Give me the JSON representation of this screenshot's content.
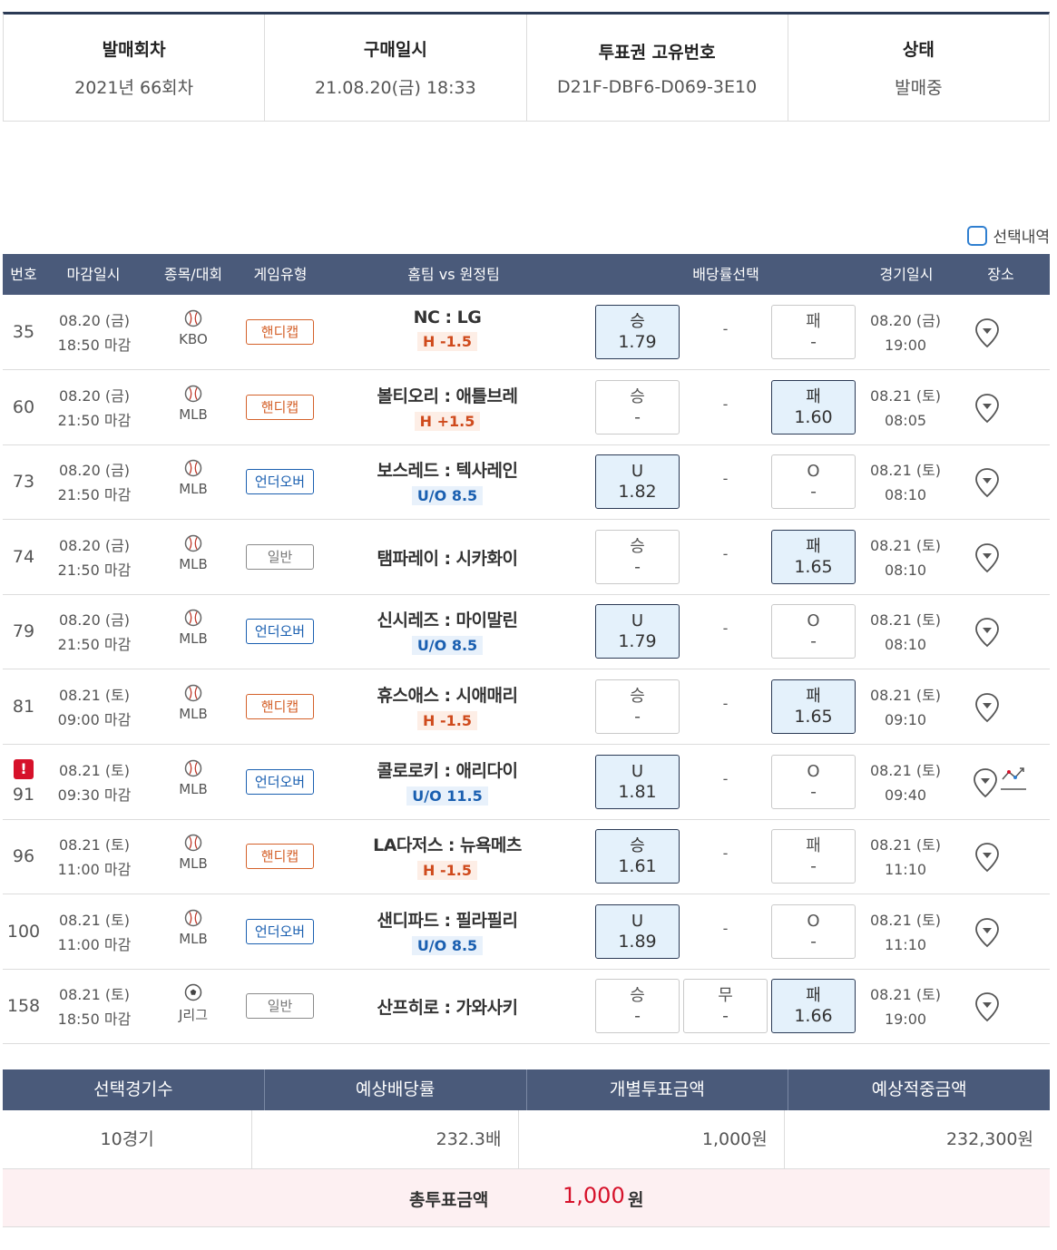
{
  "ticket_info": {
    "round_label": "발매회차",
    "round_value": "2021년 66회차",
    "purchase_label": "구매일시",
    "purchase_value": "21.08.20(금) 18:33",
    "ticket_id_label": "투표권 고유번호",
    "ticket_id_value": "D21F-DBF6-D069-3E10",
    "status_label": "상태",
    "status_value": "발매중"
  },
  "selection_toggle": {
    "label": "선택내역",
    "checked": false
  },
  "table": {
    "headers": {
      "no": "번호",
      "deadline": "마감일시",
      "sport": "종목/대회",
      "game_type": "게임유형",
      "teams": "홈팀 vs 원정팀",
      "odds": "배당률선택",
      "game_time": "경기일시",
      "place": "장소"
    },
    "rows": [
      {
        "no": "35",
        "dl_date": "08.20 (금)",
        "dl_time": "18:50 마감",
        "sport": "KBO",
        "sport_icon": "baseball-icon",
        "type": "핸디캡",
        "type_kind": "h",
        "home": "NC",
        "away": "LG",
        "hc": "H -1.5",
        "opt_l": "승",
        "val_l": "1.79",
        "sel_l": true,
        "mid": "-",
        "opt_r": "패",
        "val_r": "-",
        "sel_r": false,
        "gd_date": "08.20 (금)",
        "gd_time": "19:00"
      },
      {
        "no": "60",
        "dl_date": "08.20 (금)",
        "dl_time": "21:50 마감",
        "sport": "MLB",
        "sport_icon": "baseball-icon",
        "type": "핸디캡",
        "type_kind": "h",
        "home": "볼티오리",
        "away": "애틀브레",
        "hc": "H +1.5",
        "opt_l": "승",
        "val_l": "-",
        "sel_l": false,
        "mid": "-",
        "opt_r": "패",
        "val_r": "1.60",
        "sel_r": true,
        "gd_date": "08.21 (토)",
        "gd_time": "08:05"
      },
      {
        "no": "73",
        "dl_date": "08.20 (금)",
        "dl_time": "21:50 마감",
        "sport": "MLB",
        "sport_icon": "baseball-icon",
        "type": "언더오버",
        "type_kind": "u",
        "home": "보스레드",
        "away": "텍사레인",
        "hc": "U/O 8.5",
        "opt_l": "U",
        "val_l": "1.82",
        "sel_l": true,
        "mid": "-",
        "opt_r": "O",
        "val_r": "-",
        "sel_r": false,
        "gd_date": "08.21 (토)",
        "gd_time": "08:10"
      },
      {
        "no": "74",
        "dl_date": "08.20 (금)",
        "dl_time": "21:50 마감",
        "sport": "MLB",
        "sport_icon": "baseball-icon",
        "type": "일반",
        "type_kind": "n",
        "home": "탬파레이",
        "away": "시카화이",
        "hc": "",
        "opt_l": "승",
        "val_l": "-",
        "sel_l": false,
        "mid": "-",
        "opt_r": "패",
        "val_r": "1.65",
        "sel_r": true,
        "gd_date": "08.21 (토)",
        "gd_time": "08:10"
      },
      {
        "no": "79",
        "dl_date": "08.20 (금)",
        "dl_time": "21:50 마감",
        "sport": "MLB",
        "sport_icon": "baseball-icon",
        "type": "언더오버",
        "type_kind": "u",
        "home": "신시레즈",
        "away": "마이말린",
        "hc": "U/O 8.5",
        "opt_l": "U",
        "val_l": "1.79",
        "sel_l": true,
        "mid": "-",
        "opt_r": "O",
        "val_r": "-",
        "sel_r": false,
        "gd_date": "08.21 (토)",
        "gd_time": "08:10"
      },
      {
        "no": "81",
        "dl_date": "08.21 (토)",
        "dl_time": "09:00 마감",
        "sport": "MLB",
        "sport_icon": "baseball-icon",
        "type": "핸디캡",
        "type_kind": "h",
        "home": "휴스애스",
        "away": "시애매리",
        "hc": "H -1.5",
        "opt_l": "승",
        "val_l": "-",
        "sel_l": false,
        "mid": "-",
        "opt_r": "패",
        "val_r": "1.65",
        "sel_r": true,
        "gd_date": "08.21 (토)",
        "gd_time": "09:10"
      },
      {
        "no": "91",
        "warn": "!",
        "dl_date": "08.21 (토)",
        "dl_time": "09:30 마감",
        "sport": "MLB",
        "sport_icon": "baseball-icon",
        "type": "언더오버",
        "type_kind": "u",
        "home": "콜로로키",
        "away": "애리다이",
        "hc": "U/O 11.5",
        "opt_l": "U",
        "val_l": "1.81",
        "sel_l": true,
        "mid": "-",
        "opt_r": "O",
        "val_r": "-",
        "sel_r": false,
        "gd_date": "08.21 (토)",
        "gd_time": "09:40",
        "trend": true
      },
      {
        "no": "96",
        "dl_date": "08.21 (토)",
        "dl_time": "11:00 마감",
        "sport": "MLB",
        "sport_icon": "baseball-icon",
        "type": "핸디캡",
        "type_kind": "h",
        "home": "LA다저스",
        "away": "뉴욕메츠",
        "hc": "H -1.5",
        "opt_l": "승",
        "val_l": "1.61",
        "sel_l": true,
        "mid": "-",
        "opt_r": "패",
        "val_r": "-",
        "sel_r": false,
        "gd_date": "08.21 (토)",
        "gd_time": "11:10"
      },
      {
        "no": "100",
        "dl_date": "08.21 (토)",
        "dl_time": "11:00 마감",
        "sport": "MLB",
        "sport_icon": "baseball-icon",
        "type": "언더오버",
        "type_kind": "u",
        "home": "샌디파드",
        "away": "필라필리",
        "hc": "U/O 8.5",
        "opt_l": "U",
        "val_l": "1.89",
        "sel_l": true,
        "mid": "-",
        "opt_r": "O",
        "val_r": "-",
        "sel_r": false,
        "gd_date": "08.21 (토)",
        "gd_time": "11:10"
      },
      {
        "no": "158",
        "dl_date": "08.21 (토)",
        "dl_time": "18:50 마감",
        "sport": "J리그",
        "sport_icon": "soccer-ball-icon",
        "type": "일반",
        "type_kind": "n",
        "home": "산프히로",
        "away": "가와사키",
        "hc": "",
        "opt_l": "승",
        "val_l": "-",
        "sel_l": false,
        "opt_m": "무",
        "val_m": "-",
        "sel_m": false,
        "opt_r": "패",
        "val_r": "1.66",
        "sel_r": true,
        "gd_date": "08.21 (토)",
        "gd_time": "19:00"
      }
    ]
  },
  "summary": {
    "headers": [
      "선택경기수",
      "예상배당률",
      "개별투표금액",
      "예상적중금액"
    ],
    "games": "10경기",
    "odds": "232.3배",
    "stake": "1,000원",
    "payout": "232,300원",
    "total_label": "총투표금액",
    "total_value": "1,000",
    "total_unit": "원"
  },
  "colors": {
    "header_bg": "#4a5a7a",
    "selected_bg": "#e4f1fb",
    "handicap": "#d4612a",
    "underover": "#1a5fb0",
    "total_red": "#d6112a",
    "total_bg": "#fdf0f2"
  }
}
